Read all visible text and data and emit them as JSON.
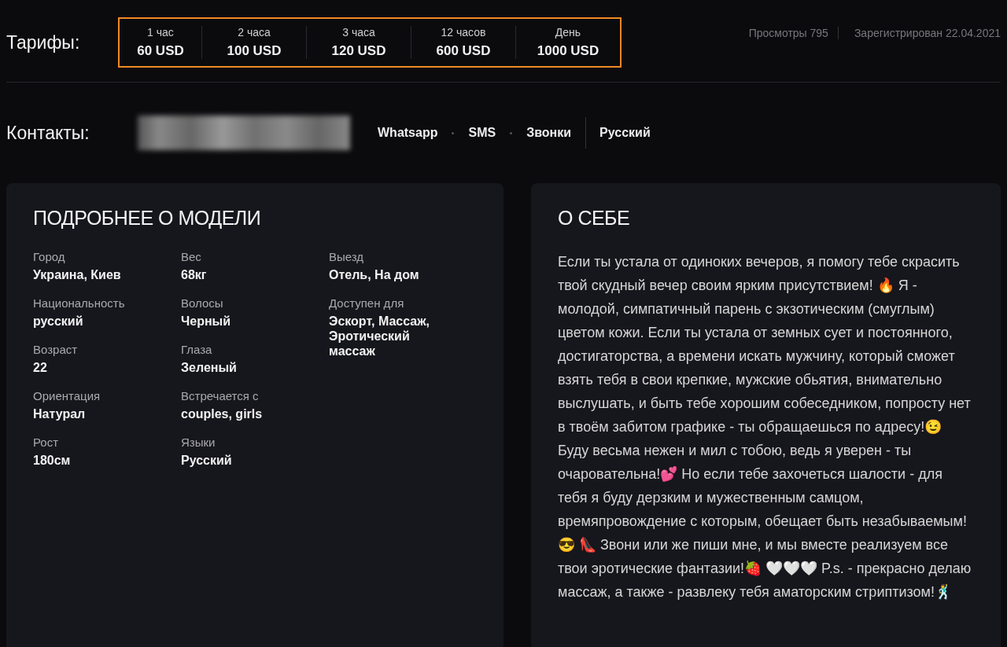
{
  "tariffs": {
    "label": "Тарифы:",
    "highlighted": true,
    "items": [
      {
        "duration": "1 час",
        "price": "60 USD"
      },
      {
        "duration": "2 часа",
        "price": "100 USD"
      },
      {
        "duration": "3 часа",
        "price": "120 USD"
      },
      {
        "duration": "12 часов",
        "price": "600 USD"
      },
      {
        "duration": "День",
        "price": "1000 USD"
      }
    ]
  },
  "stats": [
    "Просмотры 795",
    "Зарегистрирован 22.04.2021"
  ],
  "contacts": {
    "label": "Контакты:",
    "methods": [
      "Whatsapp",
      "SMS",
      "Звонки"
    ],
    "language": "Русский"
  },
  "details": {
    "title": "ПОДРОБНЕЕ О МОДЕЛИ",
    "columns": [
      [
        {
          "label": "Город",
          "value": "Украина, Киев"
        },
        {
          "label": "Национальность",
          "value": "русский"
        },
        {
          "label": "Возраст",
          "value": "22"
        },
        {
          "label": "Ориентация",
          "value": "Натурал"
        },
        {
          "label": "Рост",
          "value": "180см"
        }
      ],
      [
        {
          "label": "Вес",
          "value": "68кг"
        },
        {
          "label": "Волосы",
          "value": "Черный"
        },
        {
          "label": "Глаза",
          "value": "Зеленый"
        },
        {
          "label": "Встречается с",
          "value": "couples, girls"
        },
        {
          "label": "Языки",
          "value": "Русский"
        }
      ],
      [
        {
          "label": "Выезд",
          "value": "Отель, На дом"
        },
        {
          "label": "Доступен для",
          "value": "Эскорт, Массаж, Эротический массаж"
        }
      ]
    ]
  },
  "about": {
    "title": "О СЕБЕ",
    "text": "Если ты устала от одиноких вечеров, я помогу тебе скрасить твой скудный вечер своим ярким присутствием! 🔥 Я - молодой, симпатичный парень с экзотическим (смуглым) цветом кожи. Если ты устала от земных сует и постоянного, достигаторства, а времени искать мужчину, который сможет взять тебя в свои крепкие, мужские обьятия, внимательно выслушать, и быть тебе хорошим собеседником, попросту нет в твоём забитом графике - ты обращаешься по адресу!😉 Буду весьма нежен и мил с тобою, ведь я уверен - ты очаровательна!💕 Но если тебе захочеться шалости - для тебя я буду дерзким и мужественным самцом, времяпровождение с которым, обещает быть незабываемым!😎 👠 Звони или же пиши мне, и мы вместе реализуем все твои эротические фантазии!🍓 🤍🤍🤍 P.s. - прекрасно делаю массаж, а также - развлеку тебя аматорским стриптизом!🕺"
  }
}
